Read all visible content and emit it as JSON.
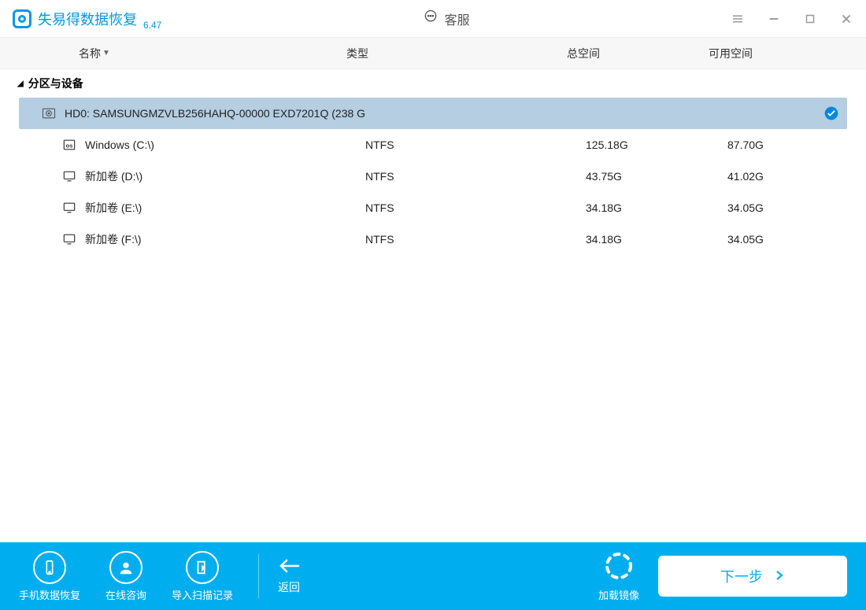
{
  "titlebar": {
    "app_title": "失易得数据恢复",
    "version": "6.47",
    "support_label": "客服"
  },
  "columns": {
    "name": "名称",
    "type": "类型",
    "total": "总空间",
    "free": "可用空间"
  },
  "section_title": "分区与设备",
  "rows": [
    {
      "label": "HD0:  SAMSUNGMZVLB256HAHQ-00000 EXD7201Q (238 G",
      "type": "",
      "total": "",
      "free": "",
      "selected": true,
      "kind": "disk"
    },
    {
      "label": "Windows (C:\\)",
      "type": "NTFS",
      "total": "125.18G",
      "free": "87.70G",
      "selected": false,
      "kind": "os"
    },
    {
      "label": "新加卷 (D:\\)",
      "type": "NTFS",
      "total": "43.75G",
      "free": "41.02G",
      "selected": false,
      "kind": "vol"
    },
    {
      "label": "新加卷 (E:\\)",
      "type": "NTFS",
      "total": "34.18G",
      "free": "34.05G",
      "selected": false,
      "kind": "vol"
    },
    {
      "label": "新加卷 (F:\\)",
      "type": "NTFS",
      "total": "34.18G",
      "free": "34.05G",
      "selected": false,
      "kind": "vol"
    }
  ],
  "footer": {
    "phone": "手机数据恢复",
    "consult": "在线咨询",
    "import": "导入扫描记录",
    "back": "返回",
    "load_image": "加载镜像",
    "next": "下一步"
  }
}
